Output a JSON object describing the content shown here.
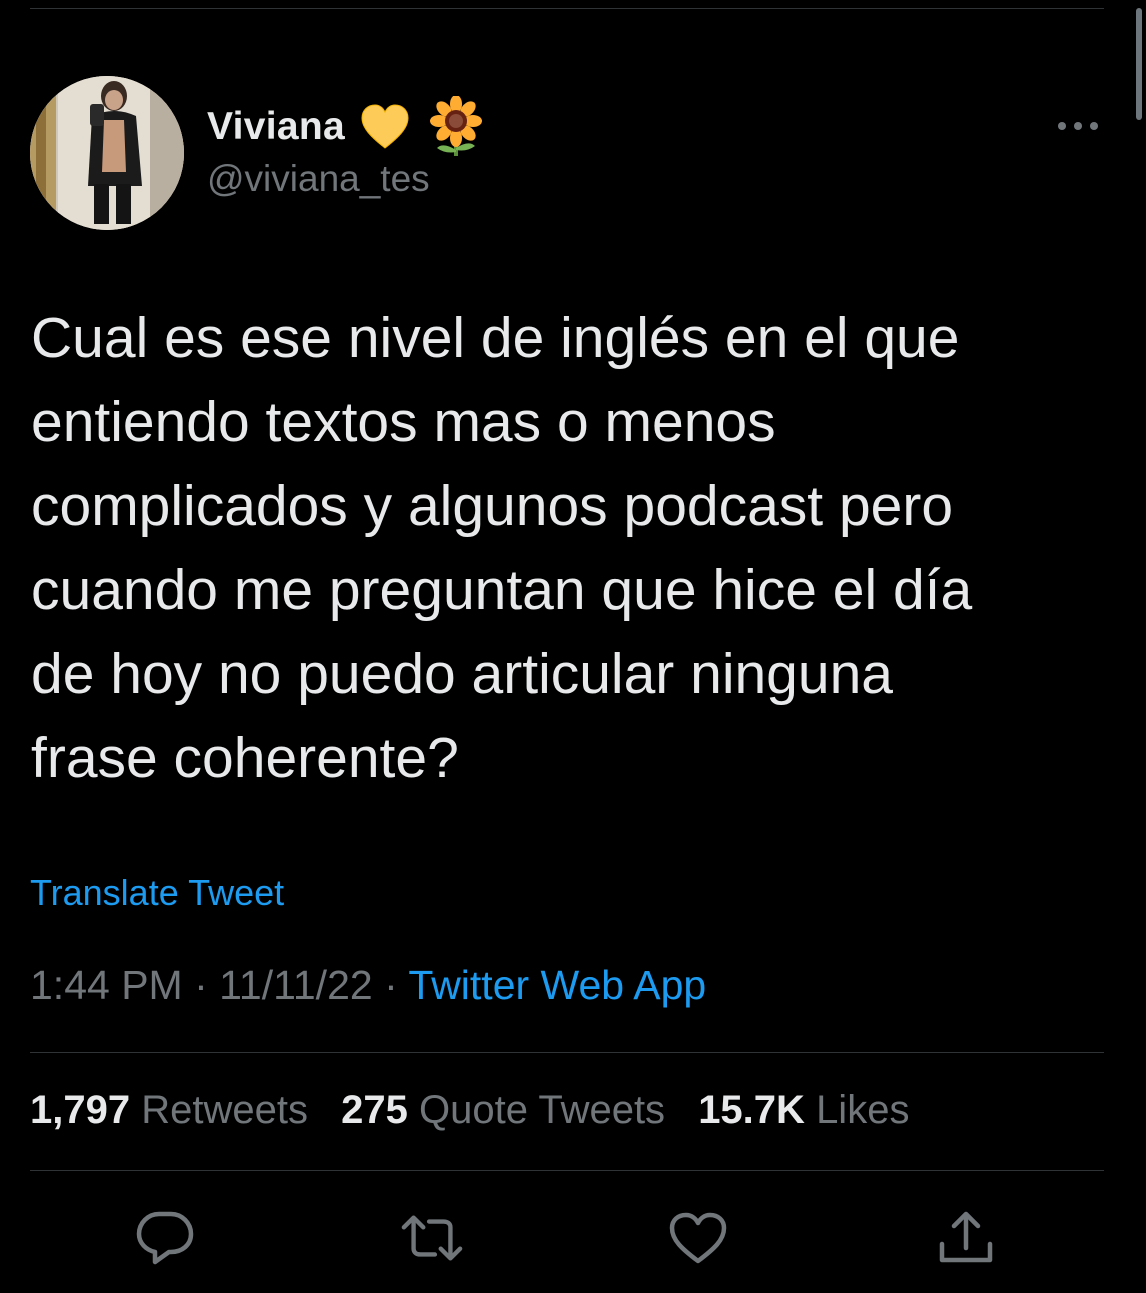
{
  "author": {
    "display_name": "Viviana",
    "handle": "@viviana_tes",
    "emoji": [
      "yellow-heart-icon",
      "sunflower-icon"
    ]
  },
  "tweet": {
    "text": "Cual es ese nivel de inglés en el que\nentiendo textos mas o menos\ncomplicados y algunos podcast pero\ncuando me preguntan que hice el día\nde hoy no puedo articular ninguna\nfrase coherente?",
    "translate_label": "Translate Tweet",
    "time": "1:44 PM",
    "date": "11/11/22",
    "separator": "·",
    "source": "Twitter Web App"
  },
  "stats": {
    "retweets_count": "1,797",
    "retweets_label": "Retweets",
    "quotes_count": "275",
    "quotes_label": "Quote Tweets",
    "likes_count": "15.7K",
    "likes_label": "Likes"
  },
  "actions": [
    "reply-icon",
    "retweet-icon",
    "like-icon",
    "share-icon"
  ],
  "colors": {
    "background": "#000000",
    "text": "#e7e9ea",
    "secondary": "#71767b",
    "accent": "#1d9bf0",
    "divider": "#2f3336"
  }
}
